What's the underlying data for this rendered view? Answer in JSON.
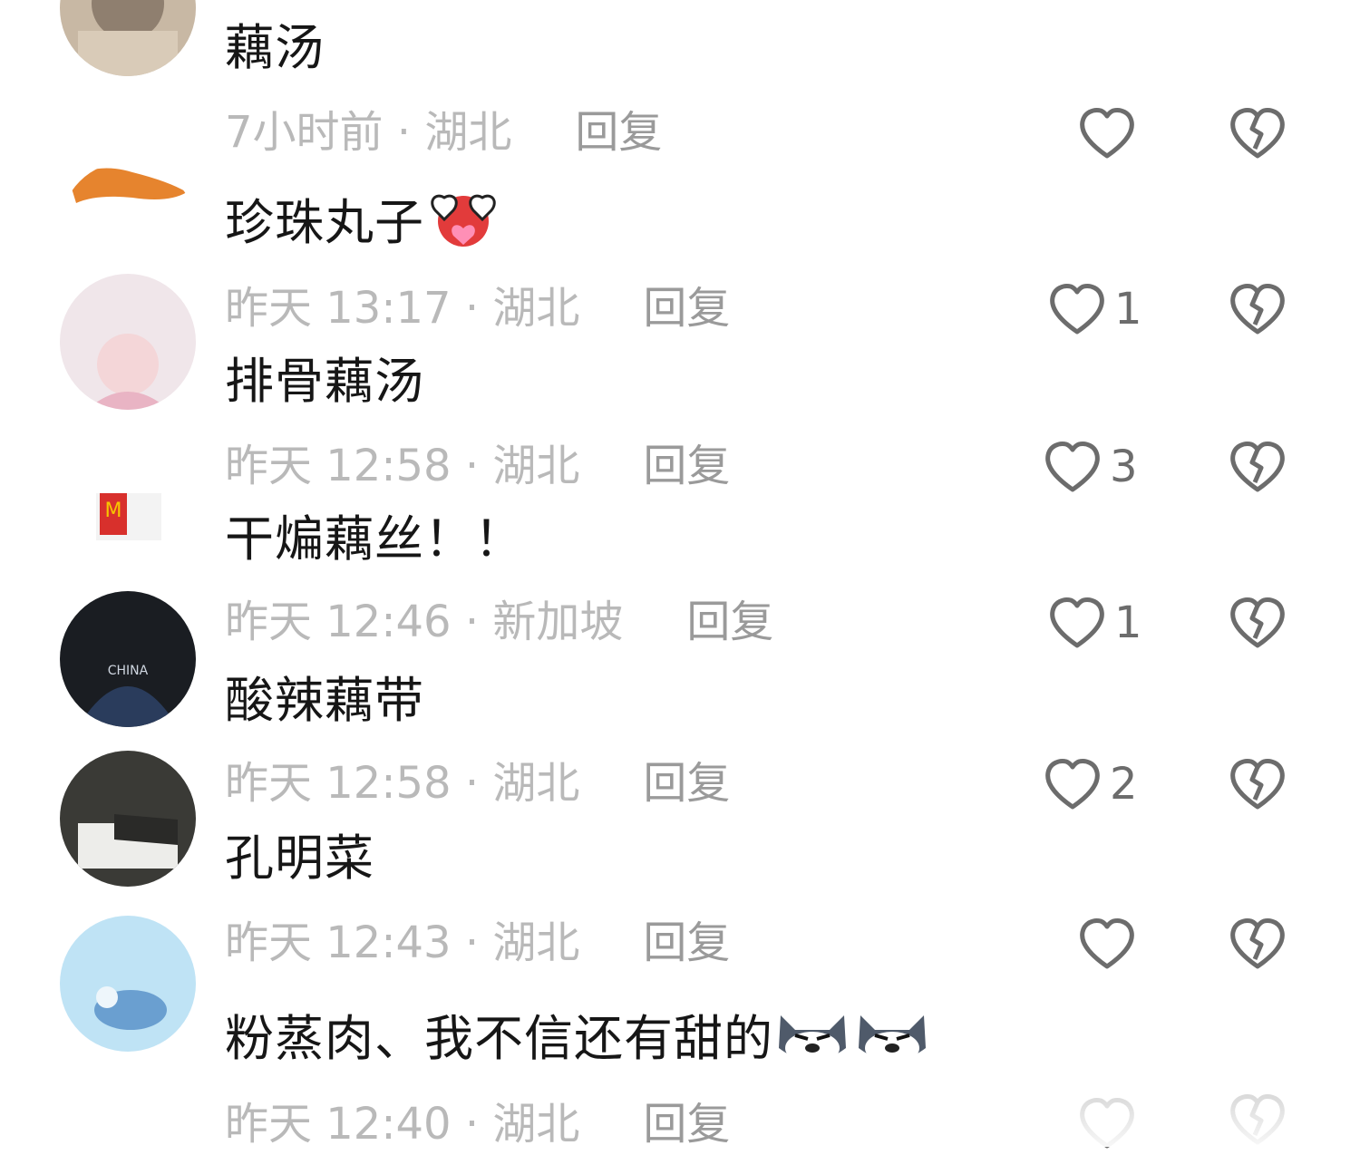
{
  "comments": [
    {
      "text": "藕汤",
      "emoji": "",
      "time": "7小时前",
      "location": "湖北",
      "reply": "回复",
      "likes": ""
    },
    {
      "text": "珍珠丸子",
      "emoji": "heart-eyes-emoji",
      "time": "昨天 13:17",
      "location": "湖北",
      "reply": "回复",
      "likes": "1"
    },
    {
      "text": "排骨藕汤",
      "emoji": "",
      "time": "昨天 12:58",
      "location": "湖北",
      "reply": "回复",
      "likes": "3"
    },
    {
      "text": "干煸藕丝！！",
      "emoji": "",
      "time": "昨天 12:46",
      "location": "新加坡",
      "reply": "回复",
      "likes": "1"
    },
    {
      "text": "酸辣藕带",
      "emoji": "",
      "time": "昨天 12:58",
      "location": "湖北",
      "reply": "回复",
      "likes": "2"
    },
    {
      "text": "孔明菜",
      "emoji": "",
      "time": "昨天 12:43",
      "location": "湖北",
      "reply": "回复",
      "likes": ""
    },
    {
      "text": "粉蒸肉、我不信还有甜的",
      "emoji": "husky-smirk-emoji",
      "time": "昨天 12:40",
      "location": "湖北",
      "reply": "回复",
      "likes": ""
    }
  ],
  "separator": " · ",
  "icons": {
    "like": "heart-outline-icon",
    "dislike": "broken-heart-icon"
  }
}
